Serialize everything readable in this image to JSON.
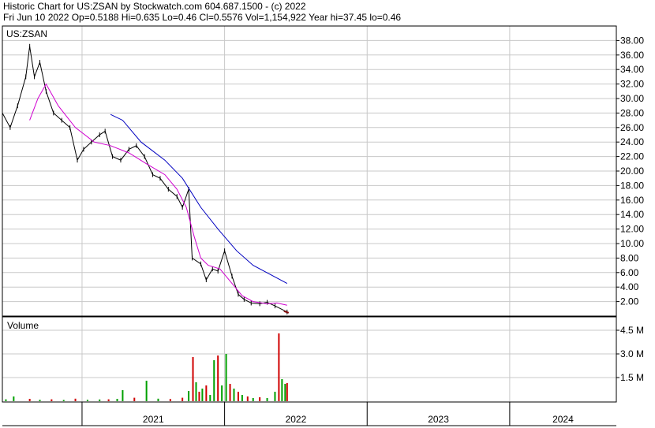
{
  "header": {
    "line1": "Historic Chart for US:ZSAN by Stockwatch.com 604.687.1500 - (c) 2022",
    "line2": "Fri Jun 10 2022   Op=0.5188   Hi=0.635   Lo=0.46   Cl=0.5576   Vol=1,154,922   Year hi=37.45   lo=0.46"
  },
  "colors": {
    "price": "#000000",
    "ma_short": "#d000d0",
    "ma_long": "#0000c0",
    "vol_up": "#00a000",
    "vol_down": "#d00000",
    "grid": "#c8c8c8",
    "last_trades": "#800000"
  },
  "chart_data": [
    {
      "type": "line",
      "title": "US:ZSAN",
      "ylim": [
        0,
        40
      ],
      "y_ticks": [
        "38.00",
        "36.00",
        "34.00",
        "32.00",
        "30.00",
        "28.00",
        "26.00",
        "24.00",
        "22.00",
        "20.00",
        "18.00",
        "16.00",
        "14.00",
        "12.00",
        "10.00",
        "8.00",
        "6.00",
        "4.00",
        "2.00"
      ],
      "x_ticks": [
        "2021",
        "2022",
        "2023",
        "2024"
      ],
      "x_tick_dates": [
        "2021-01-01",
        "2022-01-01",
        "2023-01-01",
        "2024-01-01"
      ],
      "xlim": [
        "2020-06-11",
        "2024-09-30"
      ],
      "grid": true,
      "series": [
        {
          "style": "price-bars",
          "points": [
            [
              "2020-06-11",
              28
            ],
            [
              "2020-07-01",
              26
            ],
            [
              "2020-07-20",
              29
            ],
            [
              "2020-08-10",
              33
            ],
            [
              "2020-08-20",
              37.2
            ],
            [
              "2020-09-01",
              33
            ],
            [
              "2020-09-15",
              35
            ],
            [
              "2020-10-01",
              31
            ],
            [
              "2020-10-20",
              28
            ],
            [
              "2020-11-10",
              27
            ],
            [
              "2020-12-01",
              26
            ],
            [
              "2020-12-20",
              21.5
            ],
            [
              "2021-01-05",
              23
            ],
            [
              "2021-01-25",
              24
            ],
            [
              "2021-02-15",
              25
            ],
            [
              "2021-03-01",
              25.5
            ],
            [
              "2021-03-20",
              22
            ],
            [
              "2021-04-10",
              21.5
            ],
            [
              "2021-05-01",
              23
            ],
            [
              "2021-05-20",
              23.5
            ],
            [
              "2021-06-10",
              22
            ],
            [
              "2021-07-01",
              19.5
            ],
            [
              "2021-07-20",
              19
            ],
            [
              "2021-08-10",
              17.5
            ],
            [
              "2021-09-01",
              16.5
            ],
            [
              "2021-09-15",
              15
            ],
            [
              "2021-10-01",
              17.5
            ],
            [
              "2021-10-10",
              8
            ],
            [
              "2021-11-01",
              7.2
            ],
            [
              "2021-11-15",
              5
            ],
            [
              "2021-12-01",
              6.5
            ],
            [
              "2021-12-15",
              6.2
            ],
            [
              "2022-01-01",
              9
            ],
            [
              "2022-01-20",
              5.5
            ],
            [
              "2022-02-05",
              3
            ],
            [
              "2022-02-20",
              2.3
            ],
            [
              "2022-03-10",
              1.8
            ],
            [
              "2022-04-01",
              1.7
            ],
            [
              "2022-04-20",
              1.9
            ],
            [
              "2022-05-10",
              1.4
            ],
            [
              "2022-06-10",
              0.56
            ]
          ]
        },
        {
          "style": "moving-average-short",
          "points": [
            [
              "2020-08-20",
              27
            ],
            [
              "2020-09-10",
              30
            ],
            [
              "2020-10-01",
              32
            ],
            [
              "2020-11-01",
              29
            ],
            [
              "2020-12-15",
              26
            ],
            [
              "2021-02-01",
              24
            ],
            [
              "2021-03-15",
              23.5
            ],
            [
              "2021-05-01",
              22.5
            ],
            [
              "2021-06-15",
              21
            ],
            [
              "2021-08-01",
              19.5
            ],
            [
              "2021-09-01",
              17.5
            ],
            [
              "2021-09-25",
              15
            ],
            [
              "2021-10-15",
              11
            ],
            [
              "2021-11-01",
              8
            ],
            [
              "2021-11-20",
              7
            ],
            [
              "2021-12-20",
              6.5
            ],
            [
              "2022-01-20",
              4.5
            ],
            [
              "2022-02-15",
              2.8
            ],
            [
              "2022-03-15",
              2
            ],
            [
              "2022-04-20",
              1.7
            ],
            [
              "2022-05-15",
              1.8
            ],
            [
              "2022-06-10",
              1.5
            ]
          ]
        },
        {
          "style": "moving-average-long",
          "points": [
            [
              "2021-03-15",
              27.8
            ],
            [
              "2021-04-15",
              27
            ],
            [
              "2021-06-01",
              24
            ],
            [
              "2021-08-01",
              21.5
            ],
            [
              "2021-09-15",
              19
            ],
            [
              "2021-11-01",
              15
            ],
            [
              "2021-12-15",
              12
            ],
            [
              "2022-02-01",
              9
            ],
            [
              "2022-03-15",
              7
            ],
            [
              "2022-06-10",
              4.5
            ]
          ]
        }
      ]
    },
    {
      "type": "bar",
      "title": "Volume",
      "y_ticks": [
        "4.5 M",
        "3.0 M",
        "1.5 M"
      ],
      "y_tick_values": [
        4500000,
        3000000,
        1500000
      ],
      "ylim": [
        0,
        5200000
      ],
      "bars": [
        [
          "2020-06-20",
          120000,
          "up"
        ],
        [
          "2020-07-10",
          300000,
          "up"
        ],
        [
          "2020-08-20",
          150000,
          "down"
        ],
        [
          "2020-09-15",
          90000,
          "up"
        ],
        [
          "2020-10-15",
          120000,
          "down"
        ],
        [
          "2020-11-15",
          80000,
          "up"
        ],
        [
          "2020-12-15",
          160000,
          "down"
        ],
        [
          "2021-01-15",
          90000,
          "up"
        ],
        [
          "2021-02-15",
          110000,
          "up"
        ],
        [
          "2021-03-10",
          120000,
          "down"
        ],
        [
          "2021-04-01",
          150000,
          "up"
        ],
        [
          "2021-04-15",
          700000,
          "up"
        ],
        [
          "2021-05-15",
          220000,
          "down"
        ],
        [
          "2021-06-15",
          1300000,
          "up"
        ],
        [
          "2021-07-15",
          160000,
          "up"
        ],
        [
          "2021-08-15",
          140000,
          "down"
        ],
        [
          "2021-09-15",
          220000,
          "down"
        ],
        [
          "2021-10-01",
          650000,
          "up"
        ],
        [
          "2021-10-12",
          2800000,
          "down"
        ],
        [
          "2021-10-20",
          1200000,
          "up"
        ],
        [
          "2021-10-28",
          600000,
          "down"
        ],
        [
          "2021-11-05",
          800000,
          "up"
        ],
        [
          "2021-11-15",
          1000000,
          "down"
        ],
        [
          "2021-11-25",
          400000,
          "up"
        ],
        [
          "2021-12-05",
          2600000,
          "up"
        ],
        [
          "2021-12-15",
          2900000,
          "down"
        ],
        [
          "2021-12-25",
          1000000,
          "up"
        ],
        [
          "2022-01-05",
          3000000,
          "up"
        ],
        [
          "2022-01-15",
          1100000,
          "down"
        ],
        [
          "2022-01-25",
          800000,
          "up"
        ],
        [
          "2022-02-05",
          600000,
          "down"
        ],
        [
          "2022-02-15",
          400000,
          "up"
        ],
        [
          "2022-03-01",
          300000,
          "down"
        ],
        [
          "2022-03-15",
          200000,
          "up"
        ],
        [
          "2022-04-01",
          250000,
          "down"
        ],
        [
          "2022-04-20",
          200000,
          "up"
        ],
        [
          "2022-05-10",
          600000,
          "up"
        ],
        [
          "2022-05-20",
          4300000,
          "down"
        ],
        [
          "2022-05-28",
          1400000,
          "up"
        ],
        [
          "2022-06-05",
          1100000,
          "up"
        ],
        [
          "2022-06-10",
          1154922,
          "down"
        ]
      ]
    }
  ]
}
